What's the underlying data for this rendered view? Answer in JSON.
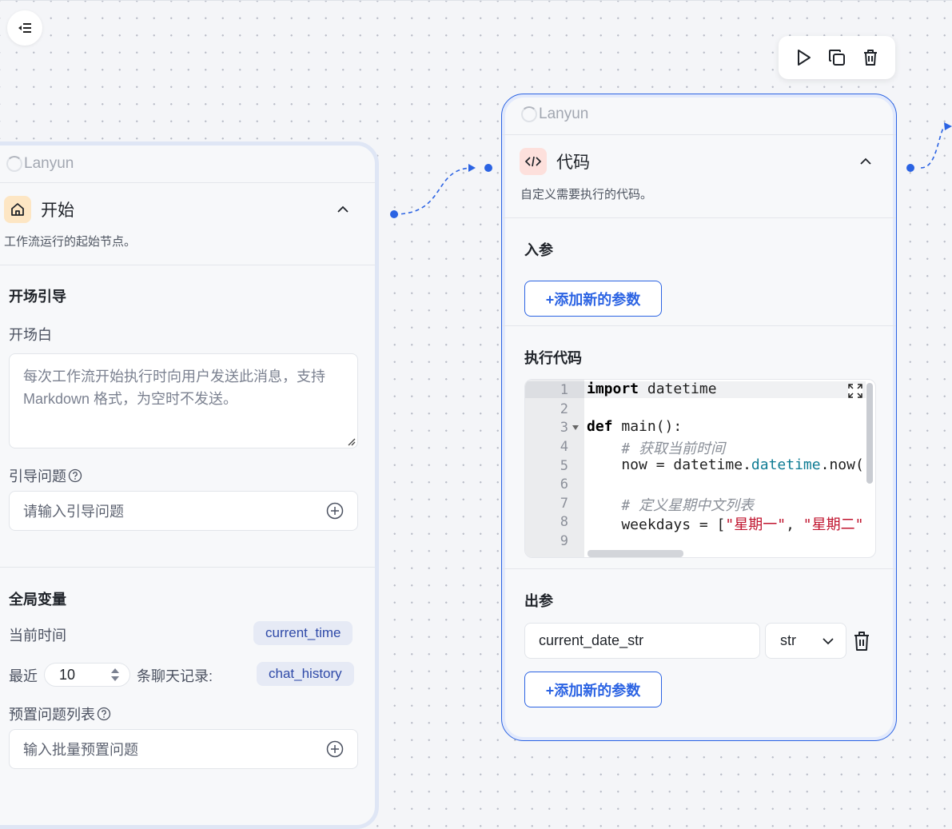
{
  "toolbar": {
    "run_label": "运行",
    "copy_label": "复制",
    "delete_label": "删除"
  },
  "start_node": {
    "brand": "Lanyun",
    "title": "开始",
    "description": "工作流运行的起始节点。",
    "opening_section": "开场引导",
    "opening_label": "开场白",
    "opening_placeholder": "每次工作流开始执行时向用户发送此消息，支持 Markdown 格式，为空时不发送。",
    "guide_label": "引导问题",
    "guide_placeholder": "请输入引导问题",
    "global_section": "全局变量",
    "current_time_label": "当前时间",
    "current_time_var": "current_time",
    "recent_label": "最近",
    "recent_count": "10",
    "chat_records_label": "条聊天记录:",
    "chat_history_var": "chat_history",
    "preset_label": "预置问题列表",
    "preset_placeholder": "输入批量预置问题"
  },
  "code_node": {
    "brand": "Lanyun",
    "title": "代码",
    "description": "自定义需要执行的代码。",
    "input_section": "入参",
    "add_param_label": "+添加新的参数",
    "code_section": "执行代码",
    "line_numbers": [
      "1",
      "2",
      "3",
      "4",
      "5",
      "6",
      "7",
      "8",
      "9"
    ],
    "code": {
      "l1_kw": "import",
      "l1_rest": " datetime",
      "l3_kw": "def",
      "l3_rest": " main():",
      "l4": "    # 获取当前时间",
      "l5_a": "    now = datetime.",
      "l5_fn": "datetime",
      "l5_b": ".now()",
      "l7": "    # 定义星期中文列表",
      "l8_a": "    weekdays = [",
      "l8_s1": "\"星期一\"",
      "l8_b": ", ",
      "l8_s2": "\"星期二\""
    },
    "output_section": "出参",
    "output_name": "current_date_str",
    "output_type": "str",
    "add_output_label": "+添加新的参数"
  },
  "colors": {
    "accent": "#2b63e3",
    "start_badge": "#fde6c4",
    "code_badge": "#fde0dc"
  }
}
